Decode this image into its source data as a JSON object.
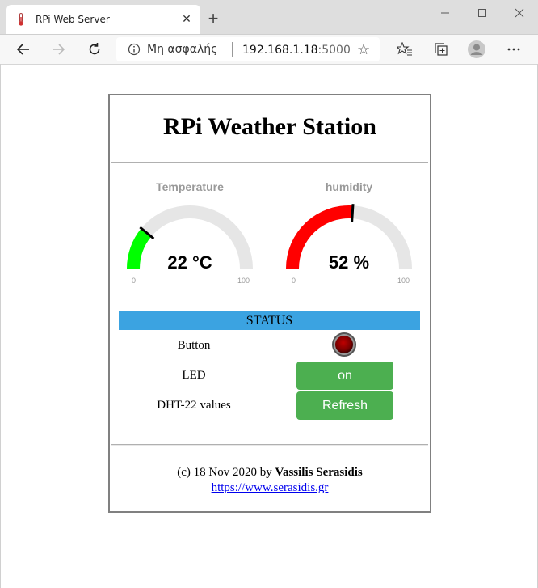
{
  "browser": {
    "tab_title": "RPi Web Server",
    "address_secure_label": "Μη ασφαλής",
    "address_host": "192.168.1.18",
    "address_port": ":5000"
  },
  "page": {
    "title": "RPi Weather Station",
    "gauges": [
      {
        "title": "Temperature",
        "value_text": "22 °C",
        "value": 22,
        "min": "0",
        "max": "100",
        "color": "#00ff00"
      },
      {
        "title": "humidity",
        "value_text": "52 %",
        "value": 52,
        "min": "0",
        "max": "100",
        "color": "#ff0000"
      }
    ],
    "status_header": "STATUS",
    "rows": {
      "button_label": "Button",
      "led_label": "LED",
      "led_button": "on",
      "dht_label": "DHT-22 values",
      "refresh_button": "Refresh"
    },
    "footer": {
      "copyright": "(c) 18 Nov 2020 by",
      "author": "Vassilis Serasidis",
      "link": "https://www.serasidis.gr"
    }
  },
  "colors": {
    "status_bar": "#3ba3e1",
    "button_green": "#4caf50",
    "indicator": "#8b0000"
  }
}
